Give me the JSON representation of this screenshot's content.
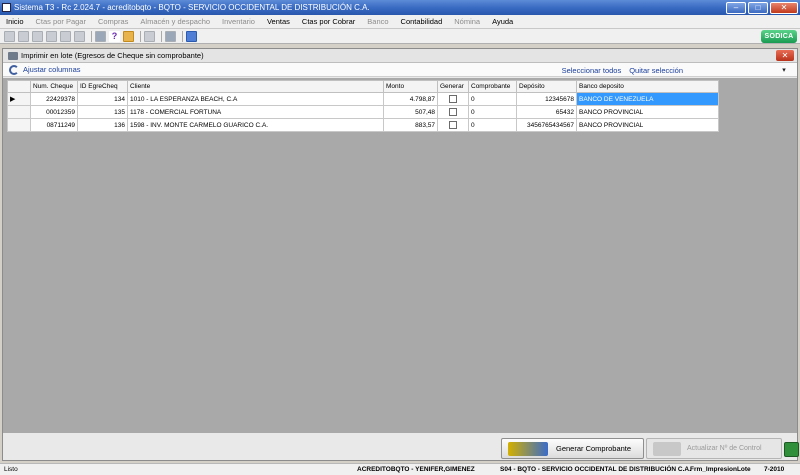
{
  "window": {
    "title": "Sistema T3 - Rc 2.024.7 - acreditobqto - BQTO - SERVICIO OCCIDENTAL DE DISTRIBUCIÓN C.A."
  },
  "menu": [
    {
      "label": "Inicio",
      "enabled": true
    },
    {
      "label": "Ctas por Pagar",
      "enabled": false
    },
    {
      "label": "Compras",
      "enabled": false
    },
    {
      "label": "Almacén y despacho",
      "enabled": false
    },
    {
      "label": "Inventario",
      "enabled": false
    },
    {
      "label": "Ventas",
      "enabled": true
    },
    {
      "label": "Ctas por Cobrar",
      "enabled": true
    },
    {
      "label": "Banco",
      "enabled": false
    },
    {
      "label": "Contabilidad",
      "enabled": true
    },
    {
      "label": "Nómina",
      "enabled": false
    },
    {
      "label": "Ayuda",
      "enabled": true
    }
  ],
  "brand": {
    "badge": "SODICA",
    "color": "#1a9a52"
  },
  "child": {
    "title": "Imprimir en lote (Egresos de Cheque sin comprobante)",
    "adjust_columns": "Ajustar columnas",
    "select_all": "Seleccionar todos",
    "clear_selection": "Quitar selección"
  },
  "grid": {
    "columns": [
      "Num. Cheque",
      "ID EgreCheq",
      "Cliente",
      "Monto",
      "Generar",
      "Comprobante",
      "Depósito",
      "Banco deposito"
    ],
    "rows": [
      {
        "num": "22429378",
        "id": "134",
        "cliente": "1010 -  LA ESPERANZA BEACH, C.A",
        "monto": "4.798,87",
        "generar": false,
        "comprobante": "0",
        "deposito": "12345678",
        "banco": "BANCO DE VENEZUELA"
      },
      {
        "num": "00012359",
        "id": "135",
        "cliente": "1178 -  COMERCIAL FORTUNA",
        "monto": "507,48",
        "generar": false,
        "comprobante": "0",
        "deposito": "65432",
        "banco": "BANCO PROVINCIAL"
      },
      {
        "num": "08711249",
        "id": "136",
        "cliente": "1598 -  INV. MONTE CARMELO GUARICO C.A.",
        "monto": "883,57",
        "generar": false,
        "comprobante": "0",
        "deposito": "3456765434567",
        "banco": "BANCO PROVINCIAL"
      }
    ]
  },
  "buttons": {
    "generate": "Generar Comprobante",
    "update": "Actualizar Nº de Control"
  },
  "status": {
    "ready": "Listo",
    "user": "ACREDITOBQTO - YENIFER,GIMENEZ",
    "company": "S04 - BQTO - SERVICIO OCCIDENTAL DE DISTRIBUCIÓN C.A.",
    "form": "Frm_ImpresionLote",
    "period": "7-2010"
  }
}
